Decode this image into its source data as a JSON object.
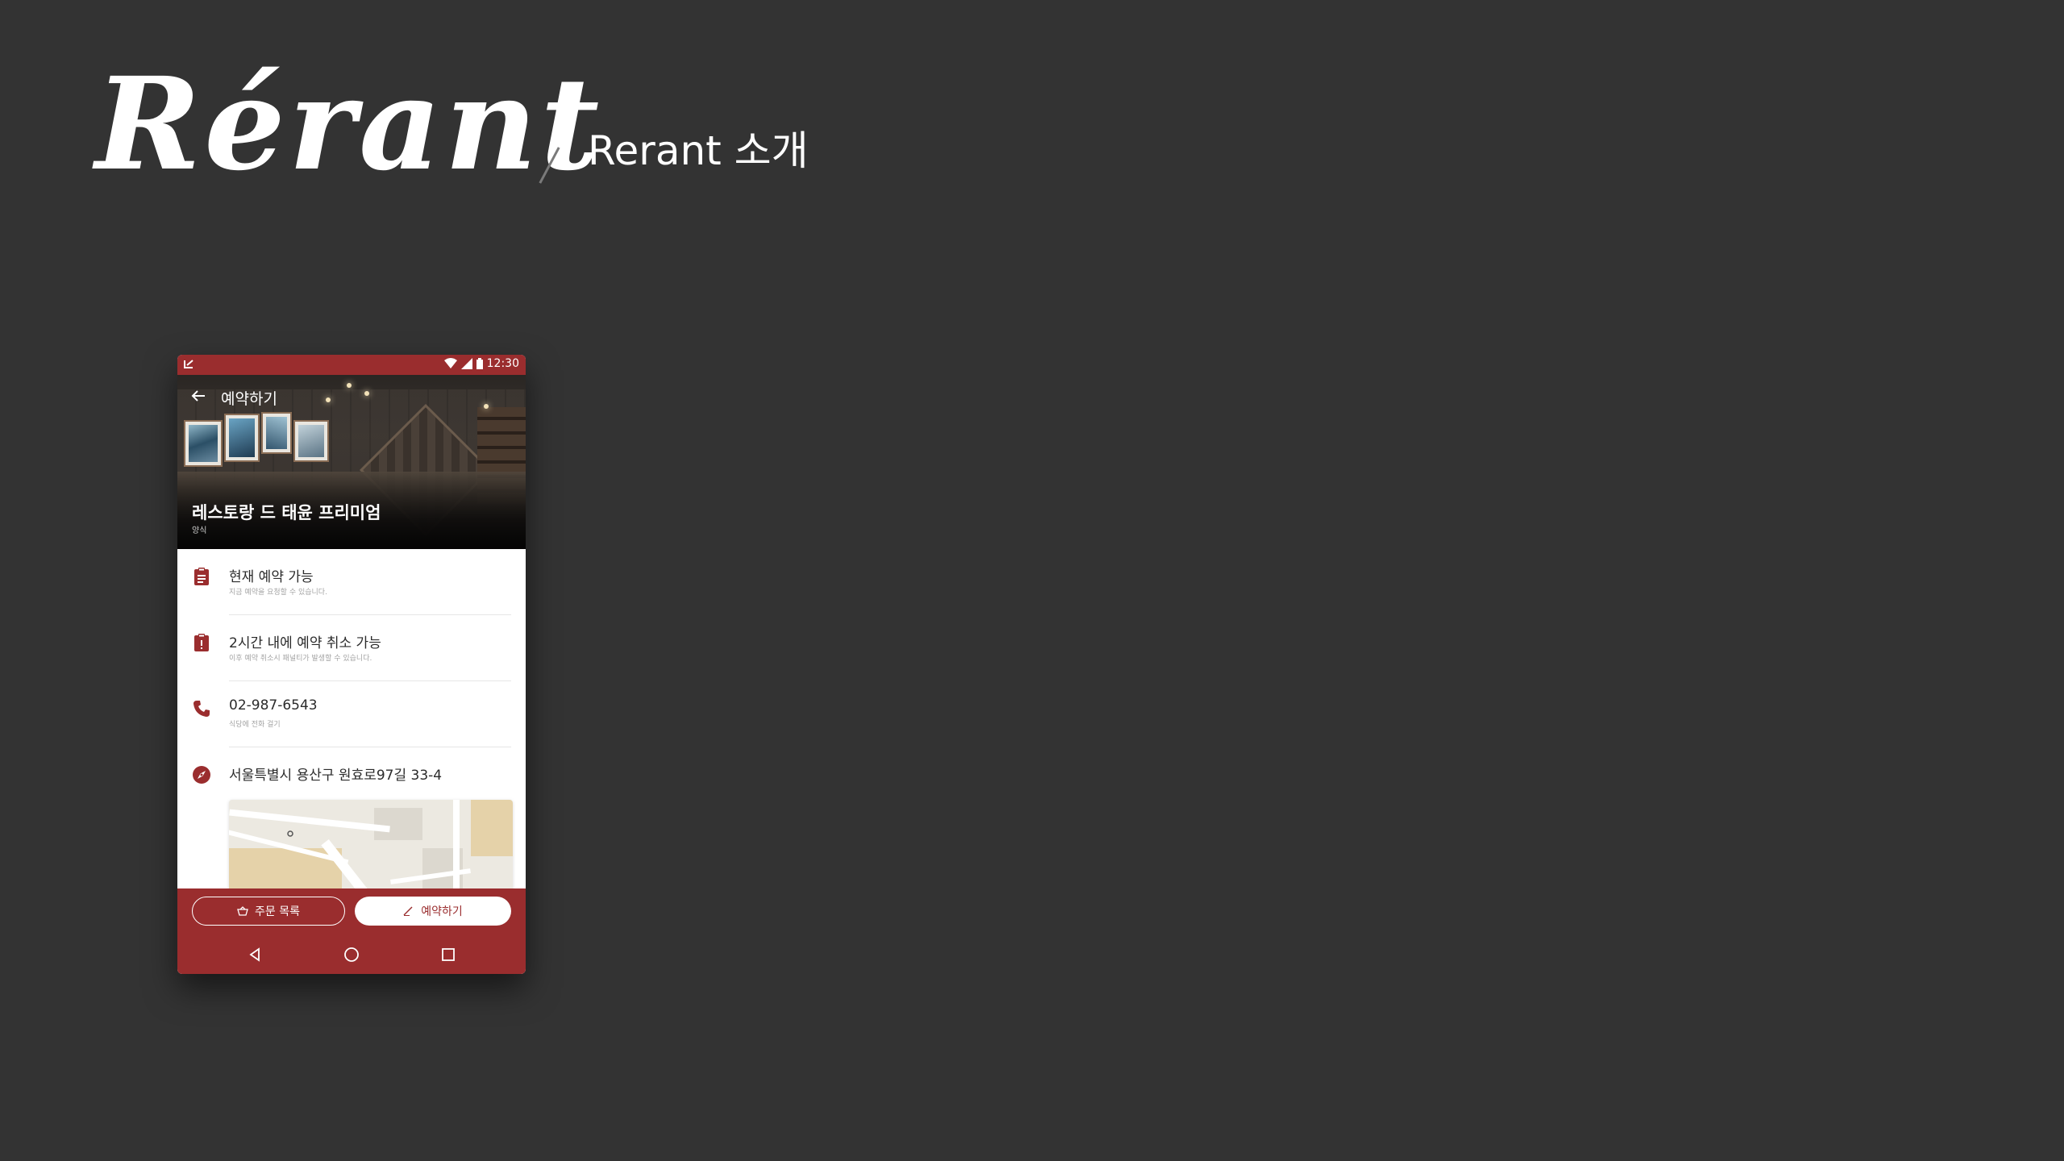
{
  "header": {
    "logo": "Rérant",
    "subtitle": "Rerant 소개"
  },
  "status_bar": {
    "time": "12:30",
    "icons": [
      "wifi-icon",
      "signal-icon",
      "battery-icon"
    ]
  },
  "toolbar": {
    "title": "예약하기"
  },
  "restaurant": {
    "name": "레스토랑 드 태윤 프리미엄",
    "category": "양식"
  },
  "info_items": [
    {
      "icon": "clipboard-icon",
      "title": "현재 예약 가능",
      "subtitle": "지금 예약을 요청할 수 있습니다."
    },
    {
      "icon": "clipboard-alert-icon",
      "title": "2시간 내에 예약 취소 가능",
      "subtitle": "이후 예약 취소시 패널티가 발생할 수 있습니다."
    },
    {
      "icon": "phone-icon",
      "title": "02-987-6543",
      "subtitle": "식당에 전화 걸기"
    },
    {
      "icon": "compass-icon",
      "title": "서울특별시 용산구 원효로97길 33-4"
    }
  ],
  "actions": {
    "order_list": "주문 목록",
    "reserve": "예약하기"
  },
  "colors": {
    "background": "#333333",
    "brand": "#9a2d2e",
    "text": "#2b2b2b"
  }
}
